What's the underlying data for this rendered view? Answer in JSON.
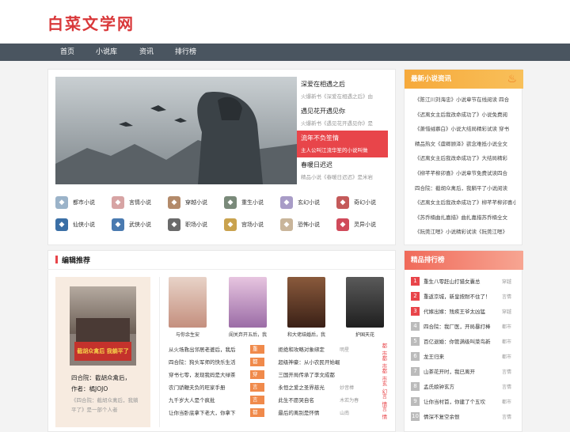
{
  "site": {
    "logo": "白菜文学网"
  },
  "nav": [
    "首页",
    "小说库",
    "资讯",
    "排行榜"
  ],
  "hot": [
    {
      "title": "深爱在相遇之后",
      "desc": "火爆新书《深爱在相遇之后》由"
    },
    {
      "title": "遇见花开遇见你",
      "desc": "火爆新书《遇见花开遇见你》是"
    },
    {
      "title": "流年不负笙情",
      "desc": "主人公叫江流华笙的小说叫做"
    },
    {
      "title": "春暖日迟迟",
      "desc": "精品小说《春暖日迟迟》是米岩"
    }
  ],
  "categories": [
    {
      "label": "都市小说",
      "color": "#9bb3c9"
    },
    {
      "label": "言情小说",
      "color": "#d7a4a4"
    },
    {
      "label": "穿越小说",
      "color": "#b38a6a"
    },
    {
      "label": "重生小说",
      "color": "#7a8a7a"
    },
    {
      "label": "玄幻小说",
      "color": "#a89cc7"
    },
    {
      "label": "奇幻小说",
      "color": "#c45a5a"
    },
    {
      "label": "仙侠小说",
      "color": "#3a6fa6"
    },
    {
      "label": "武侠小说",
      "color": "#4a7ab0"
    },
    {
      "label": "职场小说",
      "color": "#6a6a6a"
    },
    {
      "label": "宫场小说",
      "color": "#c9a24e"
    },
    {
      "label": "恐怖小说",
      "color": "#c9b59a"
    },
    {
      "label": "灵异小说",
      "color": "#d04a5a"
    }
  ],
  "news": {
    "title": "最新小说资讯",
    "items": [
      "《陈江川刘海忠》小说章节在线阅读 四合",
      "《迟离女主后我改命成功了》小说免费阅",
      "《萧惜绒慕白》小说大结局精彩试读 穿书",
      "精品热文《虞卿顾泽》欲念难抵小说全文",
      "《迟离女主后我改命成功了》大结局精彩",
      "《柳芊芊柳卯喜》小说章节免费试读四合",
      "四合院：截胡众禽后，我躺平了小说阅读",
      "《迟离女主后我改命成功了》柳芊芊柳卯喜小",
      "《苏乔楠曲扎嘉措》曲扎嘉措苏乔楠全文",
      "《阮莞江嗯》小说精彩试读《阮莞江嗯》"
    ]
  },
  "ranking": {
    "title": "精品排行榜",
    "items": [
      {
        "num": "1",
        "title": "重生八零赶山打猎女囊总",
        "cat": "穿越"
      },
      {
        "num": "2",
        "title": "重返京城，新皇按耐不住了！",
        "cat": "言情"
      },
      {
        "num": "3",
        "title": "代嫁出嫁：残疾王爷太凶猛",
        "cat": "穿越"
      },
      {
        "num": "4",
        "title": "四合院：我厂医，开局暴打棒",
        "cat": "都市"
      },
      {
        "num": "5",
        "title": "百亿退婚：你管满级叫菜鸟新",
        "cat": "都市"
      },
      {
        "num": "6",
        "title": "龙王归来",
        "cat": "都市"
      },
      {
        "num": "7",
        "title": "山茶花开时，我已离开",
        "cat": "言情"
      },
      {
        "num": "8",
        "title": "孟氏娘钟玄方",
        "cat": "言情"
      },
      {
        "num": "9",
        "title": "让你当村首，你建了个五坎",
        "cat": "都市"
      },
      {
        "num": "10",
        "title": "情深不复空余恨",
        "cat": "言情"
      }
    ]
  },
  "editor": {
    "title": "编辑推荐",
    "featured": {
      "name": "四合院：截胡众禽后，",
      "author": "作者：橘JOJO",
      "desc": "《四合院：截胡众禽后，我躺平了》是一部个人者",
      "cover_text": "截胡众禽后 我躺平了"
    },
    "books": [
      {
        "title": "与你余生安",
        "color": "#d9b3a0"
      },
      {
        "title": "闺关弃开五后，我转",
        "color": "#c9a5c9"
      },
      {
        "title": "和大佬结婚后，我",
        "color": "#6a3a2a"
      },
      {
        "title": "护国天花",
        "color": "#3a3a3a"
      }
    ],
    "rows": [
      {
        "t1": "从火场救出邻居老婆后，我后",
        "tag": "重生",
        "t2": "拒绝和攻略对象绑定",
        "au": "明星",
        "tag2": "都市"
      },
      {
        "t1": "四合院：狗头军师的快乐生活",
        "tag": "都市",
        "t2": "超级神豪：从小农民开始崛",
        "au": "",
        "tag2": "都市"
      },
      {
        "t1": "穿书七零，发现我妈是大绿茶",
        "tag": "穿越",
        "t2": "三国开局传承了李文成都",
        "au": "",
        "tag2": "都市"
      },
      {
        "t1": "农门骄鞭夫负的旺家手册",
        "tag": "言情",
        "t2": "永恒之爱之圣界慈光",
        "au": "妙音棒",
        "tag2": "玄幻"
      },
      {
        "t1": "九千岁大人是个疯批",
        "tag": "言情",
        "t2": "此生不愿哭自名",
        "au": "木若为春",
        "tag2": "言情"
      },
      {
        "t1": "让你当卧底拿下老大，你拿下",
        "tag": "都市",
        "t2": "最后的离别是怀情",
        "au": "山南",
        "tag2": "言情"
      }
    ]
  }
}
